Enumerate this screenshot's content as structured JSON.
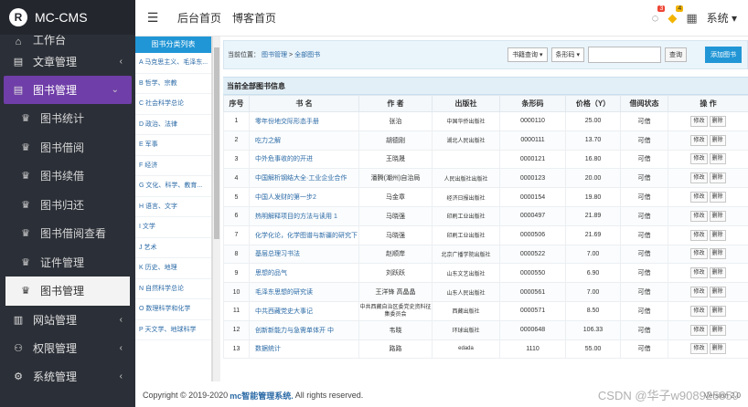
{
  "brand": {
    "name": "MC-CMS",
    "logo_letter": "R"
  },
  "sidebar": {
    "top_partial": "工作台",
    "items": [
      {
        "label": "文章管理",
        "icon": "▤"
      },
      {
        "label": "图书管理",
        "icon": "▤",
        "active": true
      },
      {
        "label": "图书统计",
        "icon": "♛",
        "sub": true
      },
      {
        "label": "图书借阅",
        "icon": "♛",
        "sub": true
      },
      {
        "label": "图书续借",
        "icon": "♛",
        "sub": true
      },
      {
        "label": "图书归还",
        "icon": "♛",
        "sub": true
      },
      {
        "label": "图书借阅查看",
        "icon": "♛",
        "sub": true
      },
      {
        "label": "证件管理",
        "icon": "♛",
        "sub": true
      },
      {
        "label": "图书管理",
        "icon": "♛",
        "sub": true,
        "current": true
      },
      {
        "label": "网站管理",
        "icon": "▥"
      },
      {
        "label": "权限管理",
        "icon": "⚇"
      },
      {
        "label": "系统管理",
        "icon": "⚙"
      }
    ],
    "chevron": "‹",
    "chevron_open": "⌄"
  },
  "topbar": {
    "menu_icon": "☰",
    "nav": [
      "后台首页",
      "博客首页"
    ],
    "msg_badge": "3",
    "notice_badge": "4",
    "system_label": "系统",
    "system_caret": "▾"
  },
  "categories": {
    "header": "图书分类列表",
    "items": [
      "A 马克思主义、毛泽东...",
      "B 哲学、宗教",
      "C 社会科学总论",
      "D 政治、法律",
      "E 军事",
      "F 经济",
      "G 文化、科学、教育...",
      "H 语言、文字",
      "I 文学",
      "J 艺术",
      "K 历史、地理",
      "N 自然科学总论",
      "O 数理科学和化学",
      "P 天文学、地球科学"
    ]
  },
  "crumb": {
    "label": "当前位置：",
    "path1": "图书管理",
    "sep": ">",
    "path2": "全部图书",
    "select1": "书籍查询 ▾",
    "select2": "条形码 ▾",
    "query_btn": "查询",
    "add_btn": "添加图书"
  },
  "table": {
    "section_title": "当前全部图书信息",
    "headers": [
      "序号",
      "书 名",
      "作 者",
      "出版社",
      "条形码",
      "价格（Y）",
      "借阅状态",
      "操 作"
    ],
    "edit_label": "修改",
    "delete_label": "删除",
    "rows": [
      [
        "1",
        "零年份地交际形态手册",
        "张治",
        "中国华侨出版社",
        "0000110",
        "25.00",
        "可借"
      ],
      [
        "2",
        "吃力之解",
        "胡德刚",
        "湖北人民出版社",
        "0000111",
        "13.70",
        "可借"
      ],
      [
        "3",
        "中外危事收的的开进",
        "王晓晟",
        "",
        "0000121",
        "16.80",
        "可借"
      ],
      [
        "4",
        "中国解析钢结大全·工业企业合作",
        "潘腾(潮州)自治局",
        "人民出版社出版社",
        "0000123",
        "20.00",
        "可借"
      ],
      [
        "5",
        "中国人发财的第一步2",
        "马金章",
        "经济日报出版社",
        "0000154",
        "19.80",
        "可借"
      ],
      [
        "6",
        "热明解释项目的方法与读用 1",
        "马晓强",
        "印刷工业出版社",
        "0000497",
        "21.89",
        "可借"
      ],
      [
        "7",
        "化学化论，化学图谱与新疆的研究下",
        "马晓强",
        "印刷工业出版社",
        "0000506",
        "21.69",
        "可借"
      ],
      [
        "8",
        "基层总理习书法",
        "赵顺岸",
        "北京广播学院出版社",
        "0000522",
        "7.00",
        "可借"
      ],
      [
        "9",
        "思想的品气",
        "刘跃跃",
        "山东文艺出版社",
        "0000550",
        "6.90",
        "可借"
      ],
      [
        "10",
        "毛泽东思想的研究读",
        "王洋锋 高晶晶",
        "山东人民出版社",
        "0000561",
        "7.00",
        "可借"
      ],
      [
        "11",
        "中共西藏党史大事记",
        "中共西藏自治区委党史资料征集委员会",
        "西藏出版社",
        "0000571",
        "8.50",
        "可借"
      ],
      [
        "12",
        "创新新能力与急需单体开 中",
        "韦晓",
        "环球出版社",
        "0000648",
        "106.33",
        "可借"
      ],
      [
        "13",
        "数据统计",
        "路路",
        "edada",
        "1110",
        "55.00",
        "可借"
      ]
    ]
  },
  "footer": {
    "prefix": "Copyright © 2019-2020",
    "brand": "mc智能管理系统.",
    "suffix": "All rights reserved.",
    "version": "Version 2.0"
  },
  "watermark": "CSDN @华子w908925859"
}
